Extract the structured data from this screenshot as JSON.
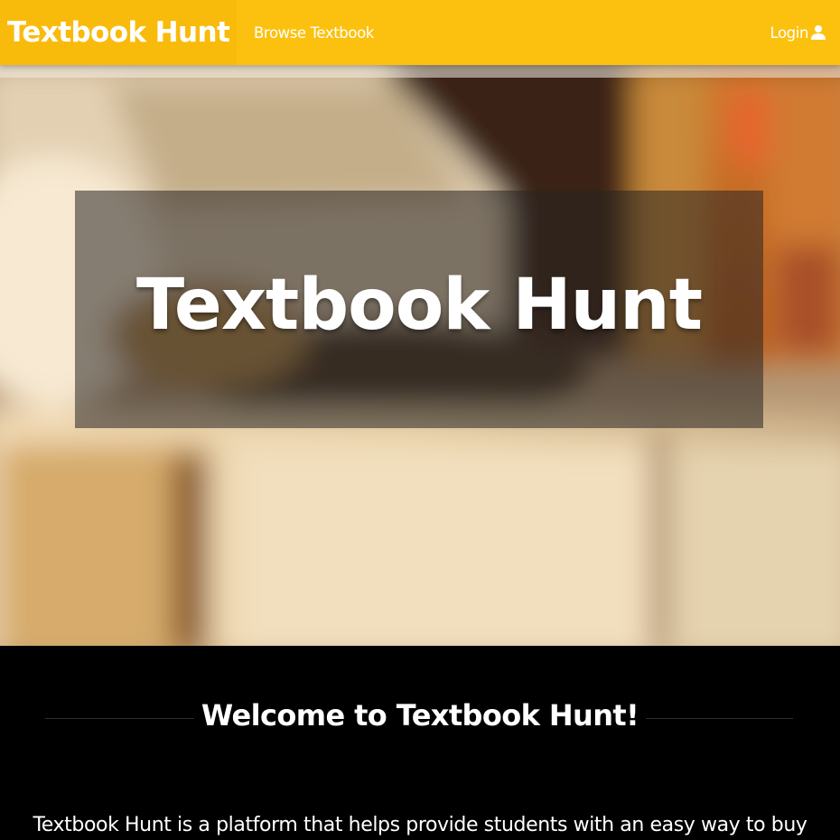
{
  "navbar": {
    "brand": "Textbook Hunt",
    "browse_link": "Browse Textbook",
    "login_link": "Login",
    "background": "#fcc10f"
  },
  "hero": {
    "title": "Textbook Hunt"
  },
  "welcome": {
    "heading": "Welcome to Textbook Hunt!",
    "text": "Textbook Hunt is a platform that helps provide students with an easy way to buy"
  },
  "icons": {
    "login": "user-icon"
  }
}
